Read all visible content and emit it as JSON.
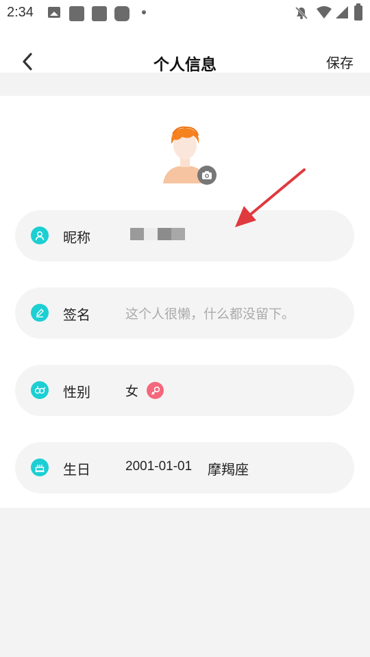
{
  "status_bar": {
    "time": "2:34",
    "icons": [
      "image-icon",
      "app-square-icon",
      "app-square-icon",
      "app-rounded-icon",
      "dot-icon",
      "bell-off-icon",
      "wifi-icon",
      "signal-icon",
      "battery-icon"
    ]
  },
  "header": {
    "back_icon": "chevron-left-icon",
    "title": "个人信息",
    "save_label": "保存"
  },
  "avatar": {
    "icon": "user-avatar-icon",
    "camera_icon": "camera-icon"
  },
  "fields": {
    "nickname": {
      "label": "昵称",
      "icon": "user-icon",
      "value_obscured": true
    },
    "signature": {
      "label": "签名",
      "icon": "pencil-icon",
      "placeholder": "这个人很懒，什么都没留下。"
    },
    "gender": {
      "label": "性别",
      "icon": "gender-icon",
      "value": "女",
      "value_icon": "female-symbol-icon"
    },
    "birthday": {
      "label": "生日",
      "icon": "cake-icon",
      "date": "2001-01-01",
      "zodiac": "摩羯座"
    }
  },
  "colors": {
    "accent": "#1ccfd3",
    "female": "#f4677d",
    "annotation_arrow": "#e0393e",
    "row_bg": "#f4f4f4",
    "page_bg": "#f3f3f3"
  }
}
